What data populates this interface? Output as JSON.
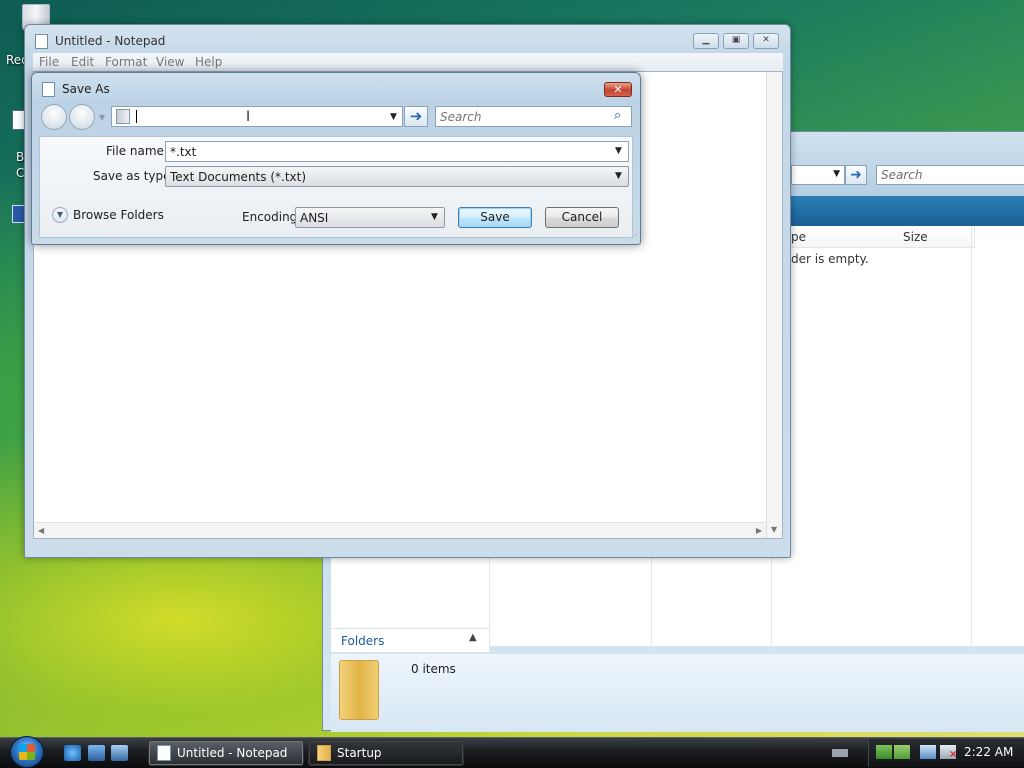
{
  "desktop": {
    "recycle_label": "Rec",
    "icon_label_1": "B",
    "icon_label_2": "C"
  },
  "explorer": {
    "search_placeholder": "Search",
    "columns": [
      "pe",
      "Size"
    ],
    "empty_message": "der is empty.",
    "folders_label": "Folders",
    "items_count": "0 items"
  },
  "notepad": {
    "title": "Untitled - Notepad",
    "menu": [
      "File",
      "Edit",
      "Format",
      "View",
      "Help"
    ],
    "window_buttons": [
      "minimize",
      "maximize",
      "close"
    ]
  },
  "saveas": {
    "title": "Save As",
    "address_value": "",
    "search_placeholder": "Search",
    "file_name_label": "File name:",
    "file_name_value": "*.txt",
    "save_type_label": "Save as type:",
    "save_type_value": "Text Documents (*.txt)",
    "browse_folders_label": "Browse Folders",
    "encoding_label": "Encoding:",
    "encoding_value": "ANSI",
    "save_label": "Save",
    "cancel_label": "Cancel"
  },
  "taskbar": {
    "tasks": [
      {
        "label": "Untitled - Notepad",
        "active": true
      },
      {
        "label": "Startup",
        "active": false
      }
    ],
    "clock": "2:22 AM"
  },
  "colors": {
    "accent": "#2d67b2",
    "close_red": "#c6442f",
    "taskbar": "#1a1c1f"
  }
}
